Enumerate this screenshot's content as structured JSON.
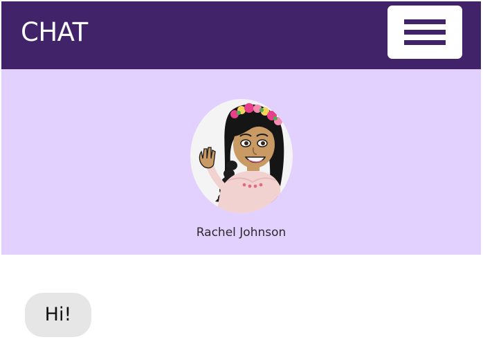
{
  "header": {
    "title": "CHAT",
    "menu_icon": "hamburger-menu-icon"
  },
  "profile": {
    "name": "Rachel Johnson",
    "avatar_icon": "bitmoji-avatar"
  },
  "messages": [
    {
      "text": "Hi!"
    }
  ],
  "colors": {
    "header_bg": "#41236a",
    "profile_band_bg": "#e2d0ff",
    "bubble_bg": "#e6e6e6"
  }
}
